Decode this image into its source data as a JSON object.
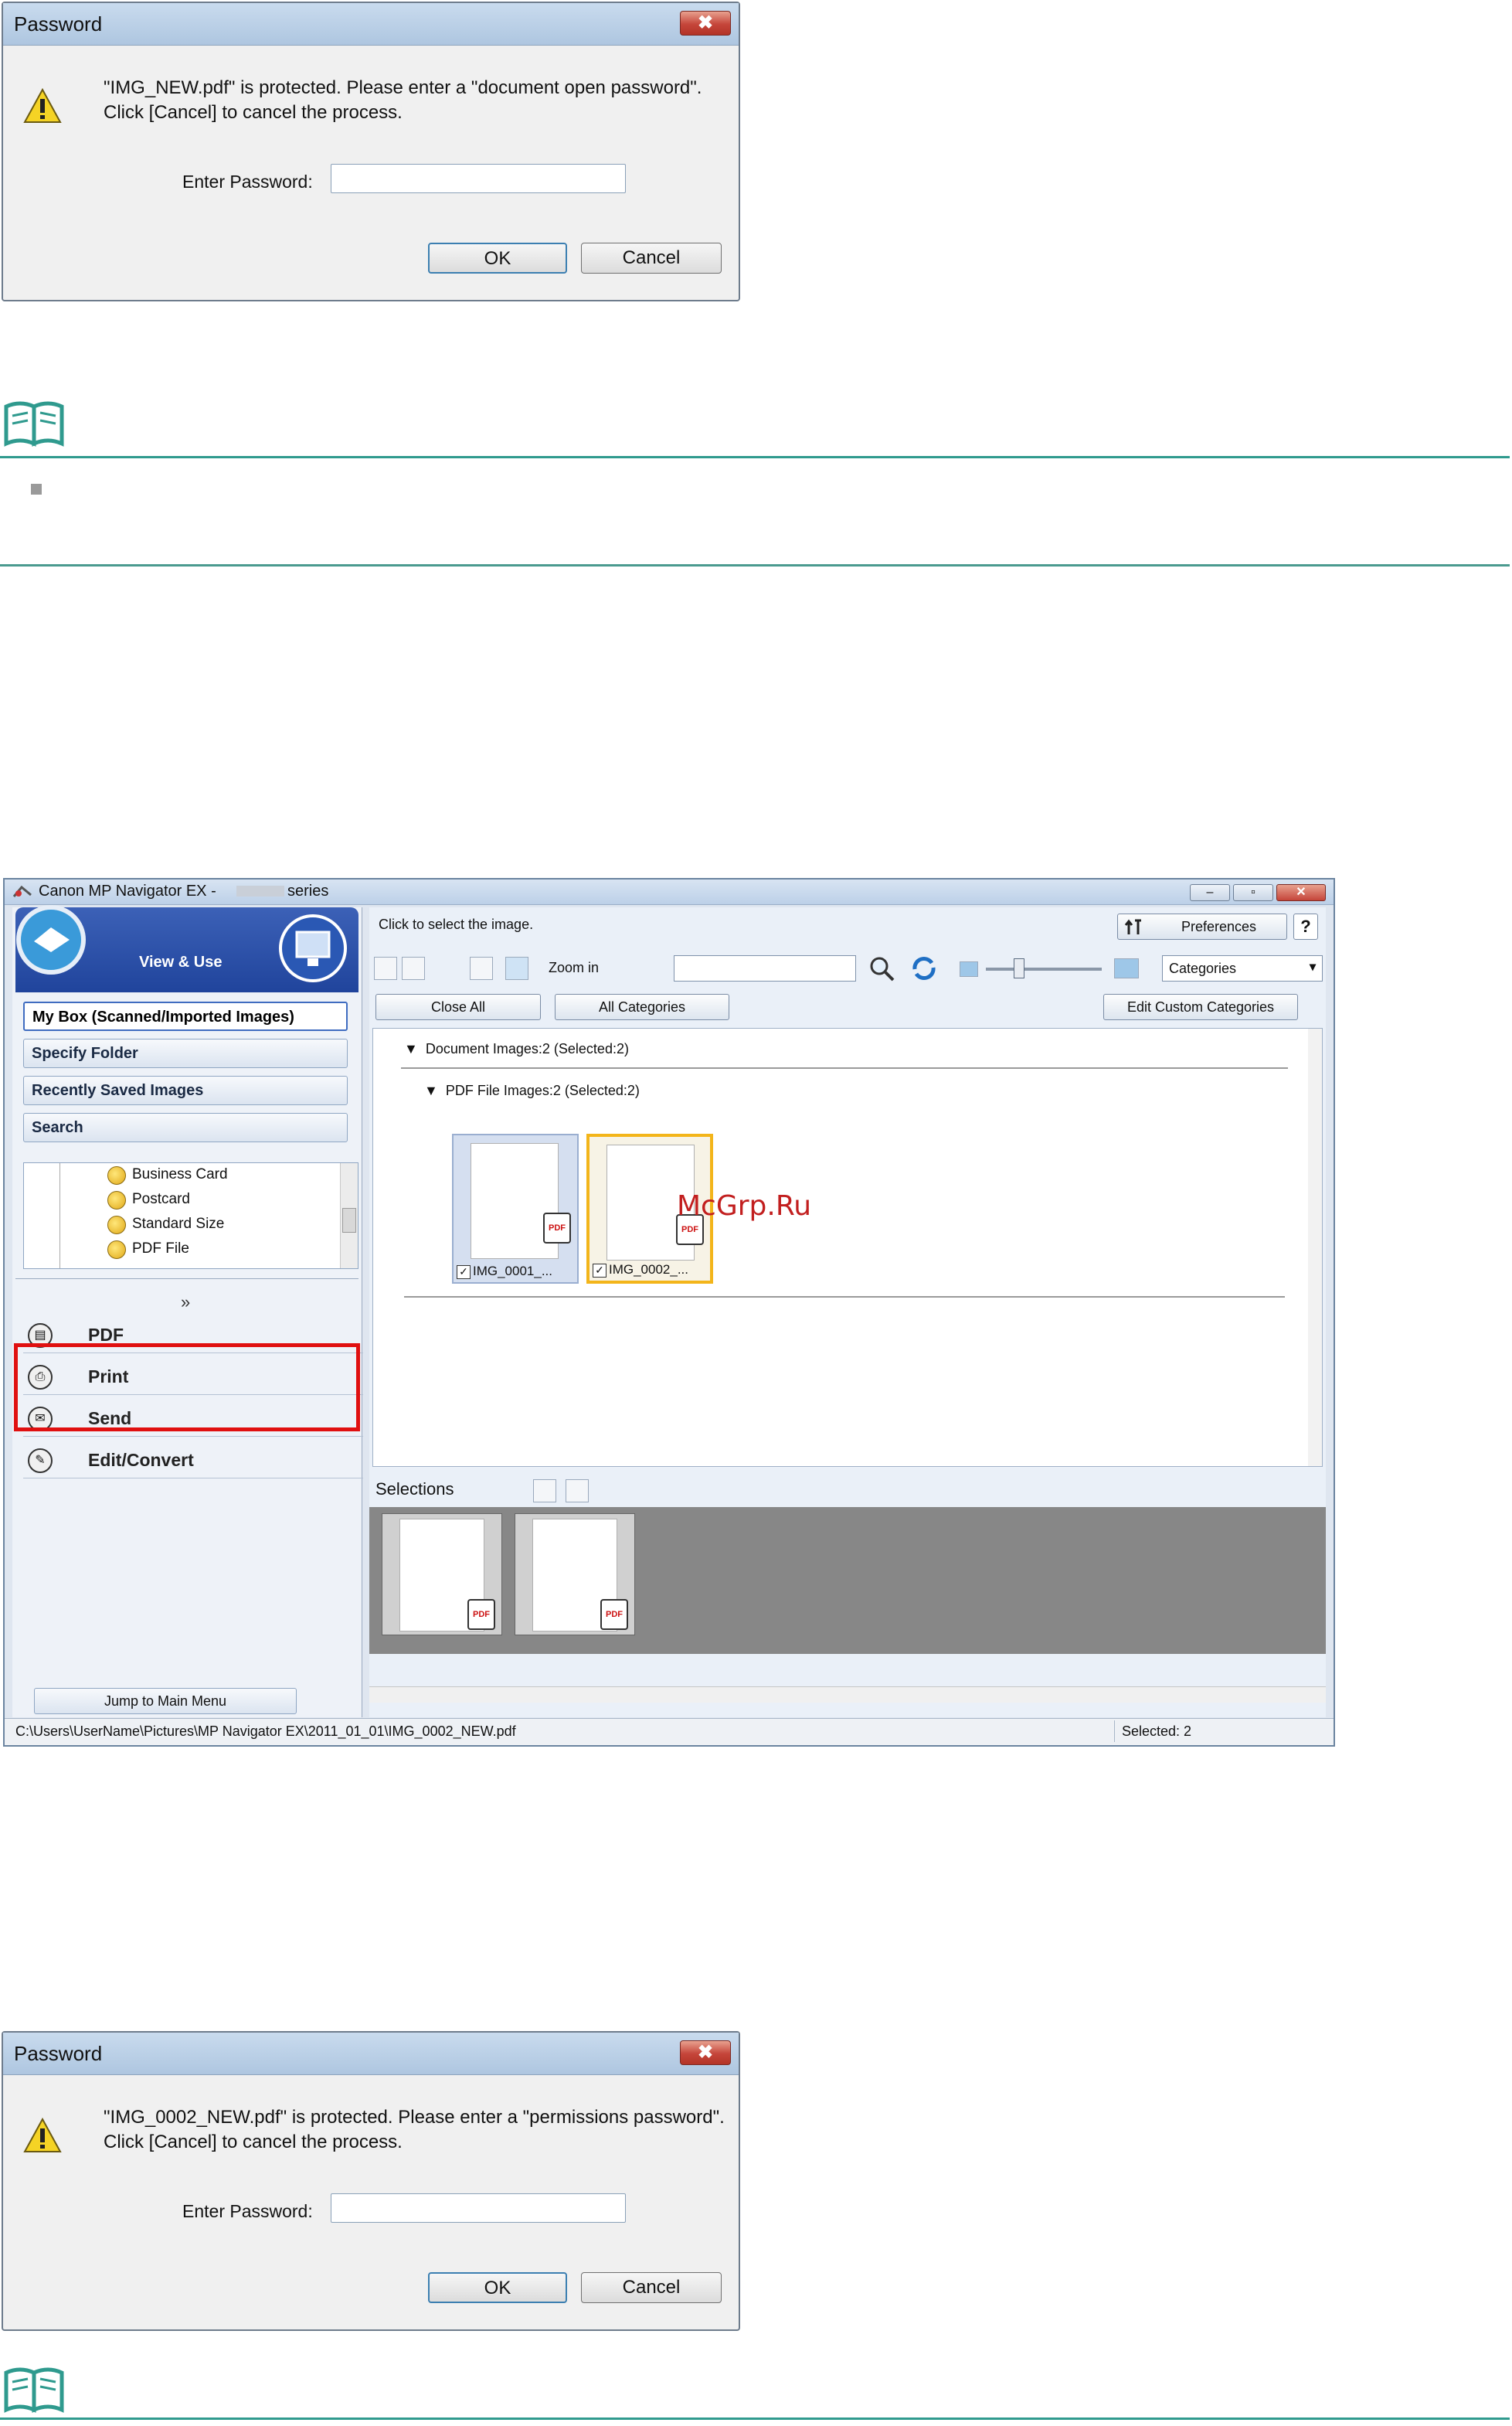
{
  "dialog1": {
    "title": "Password",
    "close": "✖",
    "message_line1": "\"IMG_NEW.pdf\" is protected. Please enter a \"document open password\".",
    "message_line2": "Click [Cancel] to cancel the process.",
    "field_label": "Enter Password:",
    "field_value": "",
    "ok": "OK",
    "cancel": "Cancel"
  },
  "app": {
    "title_left": "Canon MP Navigator EX -",
    "title_right": "series",
    "view_use": "View & Use",
    "nav": [
      "My Box (Scanned/Imported Images)",
      "Specify Folder",
      "Recently Saved Images",
      "Search"
    ],
    "tree": [
      "Business Card",
      "Postcard",
      "Standard Size",
      "PDF File"
    ],
    "expand": "»",
    "actions": [
      "PDF",
      "Print",
      "Send",
      "Edit/Convert"
    ],
    "jump": "Jump to Main Menu",
    "hint": "Click to select the image.",
    "preferences": "Preferences",
    "help": "?",
    "zoom_in": "Zoom in",
    "search_value": "",
    "categories": "Categories",
    "close_all": "Close All",
    "all_categories": "All Categories",
    "edit_custom": "Edit Custom Categories",
    "group1": "Document    Images:2    (Selected:2)",
    "group2": "PDF File    Images:2    (Selected:2)",
    "thumbs": [
      "IMG_0001_...",
      "IMG_0002_..."
    ],
    "pdf_badge": "PDF",
    "selections": "Selections",
    "status_path": "C:\\Users\\UserName\\Pictures\\MP Navigator EX\\2011_01_01\\IMG_0002_NEW.pdf",
    "status_count": "Selected: 2"
  },
  "watermark": "McGrp.Ru",
  "dialog2": {
    "title": "Password",
    "close": "✖",
    "message_line1": "\"IMG_0002_NEW.pdf\" is protected. Please enter a \"permissions password\".",
    "message_line2": "Click [Cancel] to cancel the process.",
    "field_label": "Enter Password:",
    "field_value": "",
    "ok": "OK",
    "cancel": "Cancel"
  },
  "colors": {
    "highlight": "#e01010",
    "rule": "#2f9a8e",
    "selected_thumb": "#f3b51a"
  }
}
